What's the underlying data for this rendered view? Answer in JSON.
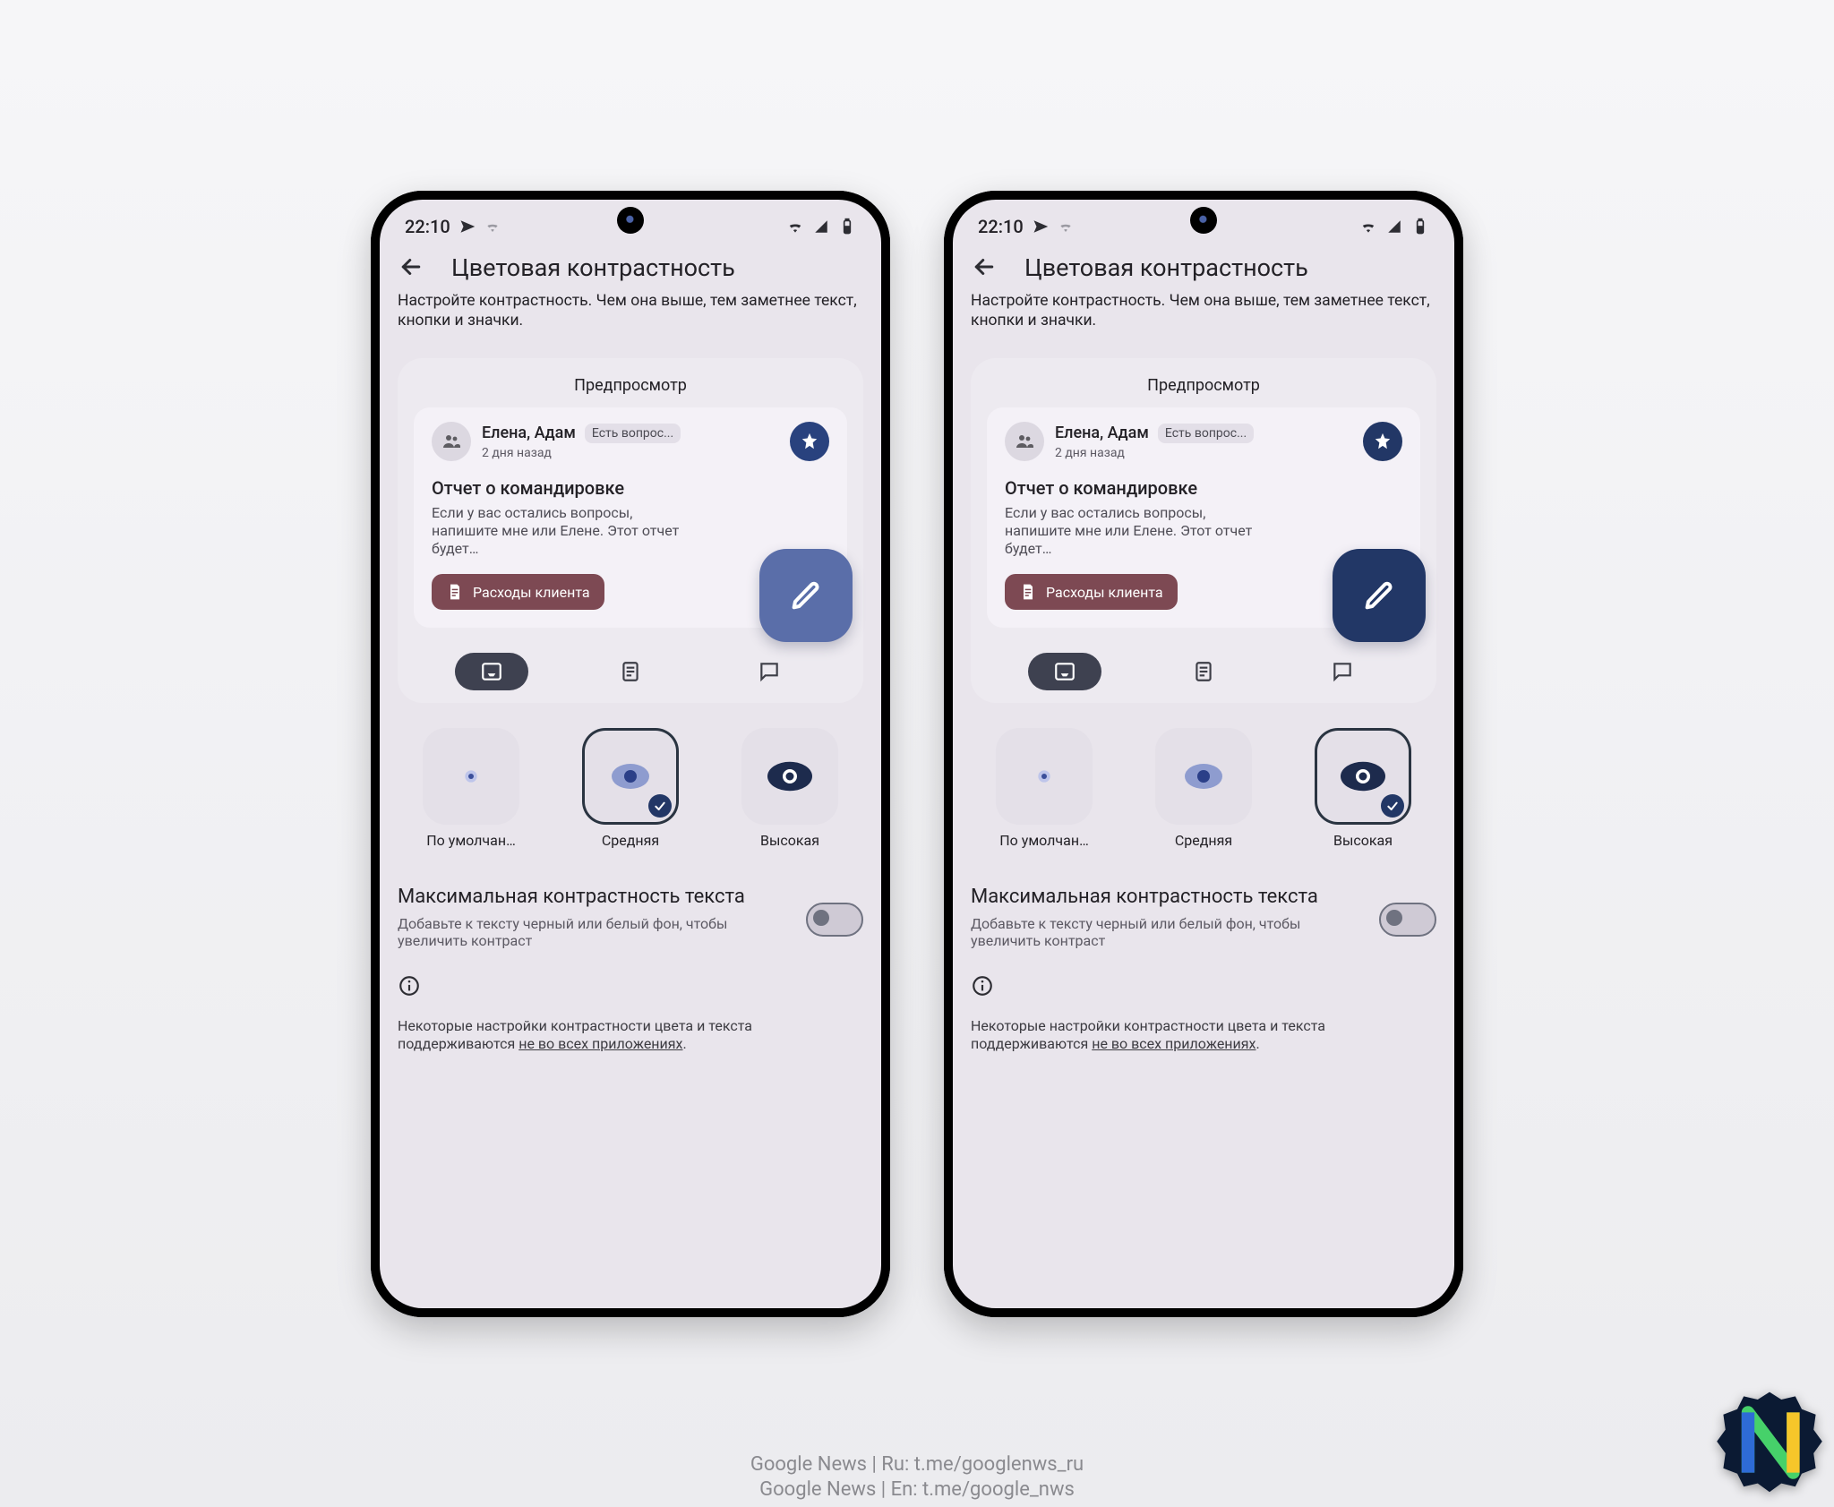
{
  "status_bar": {
    "time": "22:10"
  },
  "app_bar": {
    "title": "Цветовая контрастность"
  },
  "description": "Настройте контрастность. Чем она выше, тем заметнее текст, кнопки и значки.",
  "preview": {
    "title": "Предпросмотр",
    "contacts": "Елена, Адам",
    "chip": "Есть вопрос...",
    "timestamp": "2 дня назад",
    "subject": "Отчет о командировке",
    "body": "Если у вас остались вопросы, напишите мне или Елене. Этот отчет будет…",
    "attachment": "Расходы клиента"
  },
  "options": {
    "default": "По умолчан…",
    "medium": "Средняя",
    "high": "Высокая"
  },
  "max_contrast": {
    "title": "Максимальная контрастность текста",
    "desc": "Добавьте к тексту черный или белый фон, чтобы увеличить контраст",
    "enabled": false
  },
  "footnote": {
    "prefix": "Некоторые настройки контрастности цвета и текста поддерживаются ",
    "link": "не во всех приложениях",
    "suffix": "."
  },
  "phones": [
    {
      "variant": "medium",
      "selected": "medium"
    },
    {
      "variant": "high",
      "selected": "high"
    }
  ],
  "caption": {
    "line1": "Google News | Ru: t.me/googlenws_ru",
    "line2": "Google News | En: t.me/google_nws"
  },
  "colors": {
    "accent_blue": "#223766",
    "accent_blue_mid": "#5a6ea9",
    "maroon": "#7d4953"
  }
}
